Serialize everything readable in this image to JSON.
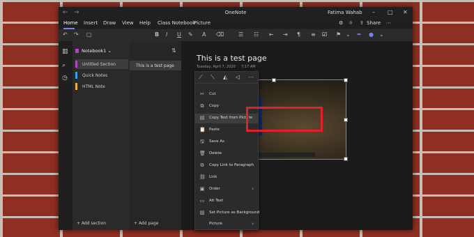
{
  "window": {
    "title": "OneNote",
    "user": "Fatima Wahab",
    "controls": {
      "minimize": "–",
      "maximize": "□",
      "close": "✕"
    }
  },
  "tabs": [
    "Home",
    "Insert",
    "Draw",
    "View",
    "Help",
    "Class Notebook",
    "Picture"
  ],
  "active_tab": "Home",
  "ribbon": {
    "share_label": "Share"
  },
  "notebook": {
    "name": "Notebook1",
    "chevron": "⌄"
  },
  "sections": [
    {
      "label": "Untitled Section",
      "color": "#b146c2"
    },
    {
      "label": "Quick Notes",
      "color": "#3aa0e8"
    },
    {
      "label": "HTML Note",
      "color": "#e8b23a"
    }
  ],
  "pages": [
    {
      "label": "This is a test page"
    }
  ],
  "footer": {
    "add_section": "Add section",
    "add_page": "Add page"
  },
  "page": {
    "title": "This is a test page",
    "date": "Tuesday, April 7, 2020",
    "time": "7:17 AM"
  },
  "context_menu": {
    "top_icons": [
      "crop-icon",
      "crop-alt-icon",
      "flip-icon",
      "rotate-icon",
      "more-icon"
    ],
    "items": [
      {
        "label": "Cut",
        "icon": "scissors-icon",
        "glyph": "✂"
      },
      {
        "label": "Copy",
        "icon": "copy-icon",
        "glyph": "⧉"
      },
      {
        "label": "Copy Text from Picture",
        "icon": "copy-text-icon",
        "glyph": "▤"
      },
      {
        "label": "Paste",
        "icon": "paste-icon",
        "glyph": "📋"
      },
      {
        "label": "Save As",
        "icon": "save-icon",
        "glyph": "🖫"
      },
      {
        "label": "Delete",
        "icon": "delete-icon",
        "glyph": "🗑"
      },
      {
        "label": "Copy Link to Paragraph",
        "icon": "link-icon",
        "glyph": "⧉"
      },
      {
        "label": "Link",
        "icon": "link-icon",
        "glyph": "⛓"
      },
      {
        "label": "Order",
        "icon": "order-icon",
        "glyph": "▣",
        "submenu": true
      },
      {
        "label": "Alt Text",
        "icon": "alt-text-icon",
        "glyph": "▭"
      },
      {
        "label": "Set Picture as Background",
        "icon": "background-icon",
        "glyph": "▨"
      },
      {
        "label": "Picture",
        "icon": "picture-icon",
        "glyph": "",
        "submenu": true
      }
    ]
  },
  "colors": {
    "accent": "#7b83eb",
    "highlight": "#e0202a"
  }
}
